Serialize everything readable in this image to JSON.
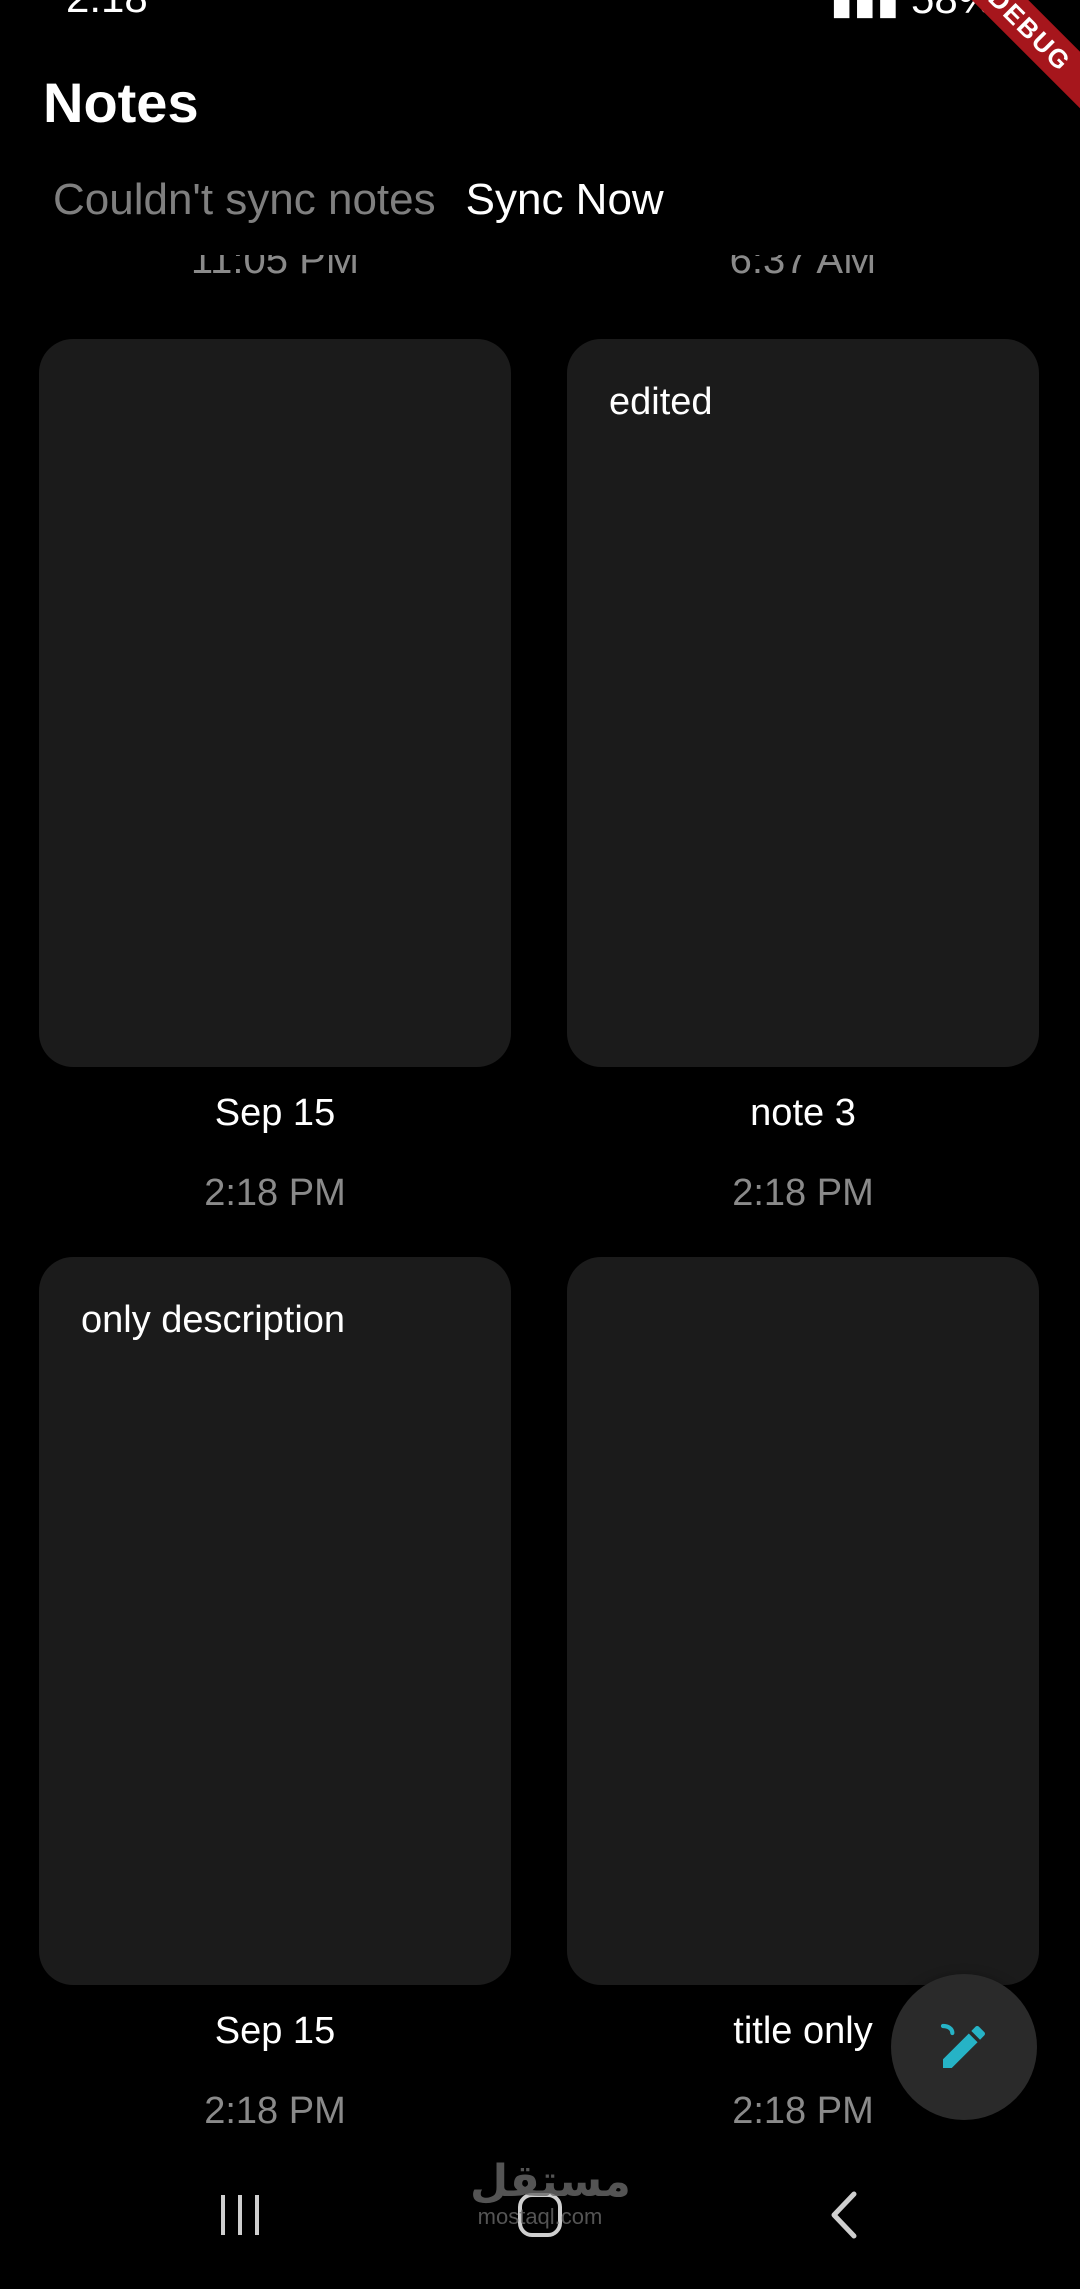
{
  "status_bar": {
    "time": "2:18",
    "battery": "58%"
  },
  "debug_banner": "DEBUG",
  "app": {
    "title": "Notes"
  },
  "sync": {
    "status_text": "Couldn't sync notes",
    "action_label": "Sync Now"
  },
  "partial_times": [
    "11:05 PM",
    "6:37 AM"
  ],
  "notes": [
    {
      "preview": "",
      "title": "Sep 15",
      "time": "2:18 PM"
    },
    {
      "preview": "edited",
      "title": "note 3",
      "time": "2:18 PM"
    },
    {
      "preview": "only description",
      "title": "Sep 15",
      "time": "2:18 PM"
    },
    {
      "preview": "",
      "title": "title only",
      "time": "2:18 PM"
    }
  ],
  "fab": {
    "icon": "edit-note-icon",
    "color": "#26b3c6"
  },
  "nav": {
    "recents_icon": "recents-icon",
    "home_icon": "home-icon",
    "back_icon": "back-icon"
  },
  "watermark": {
    "arabic": "مستقل",
    "latin": "mostaql.com"
  }
}
